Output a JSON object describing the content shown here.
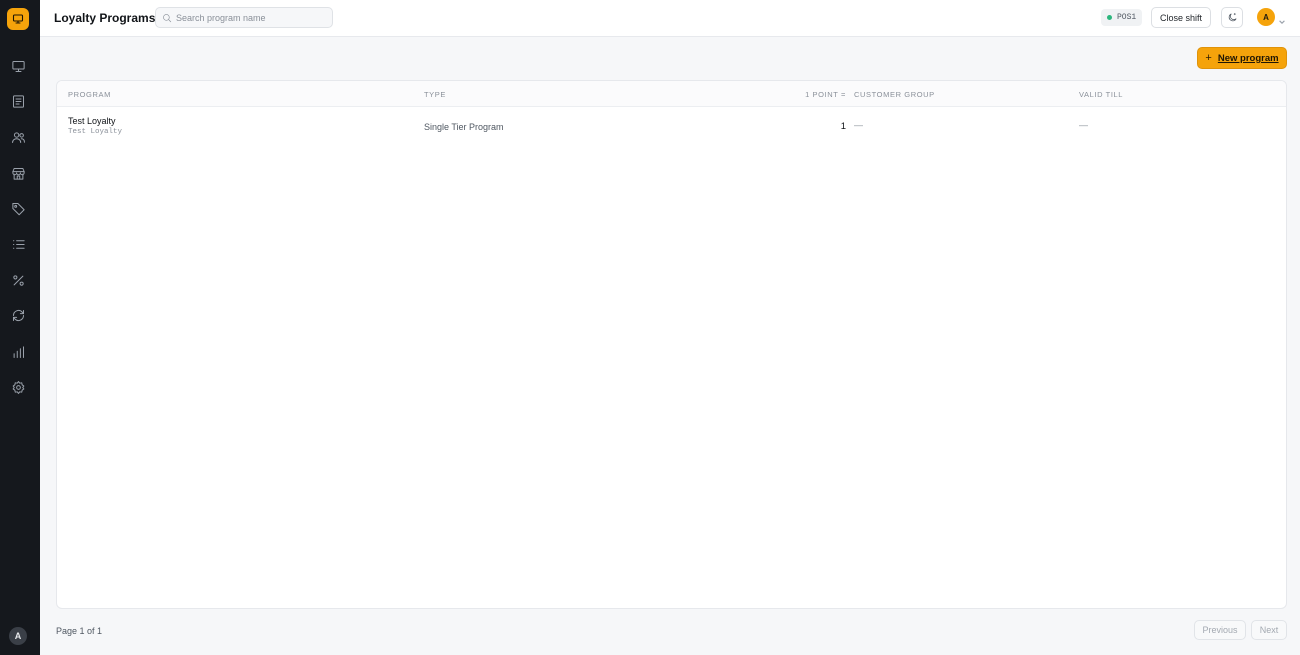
{
  "header": {
    "title": "Loyalty Programs",
    "search_placeholder": "Search program name",
    "pos_label": "POS1",
    "close_shift_label": "Close shift",
    "user_initial": "A"
  },
  "sidebar": {
    "items": [
      "monitor-icon",
      "receipt-icon",
      "users-icon",
      "store-icon",
      "tag-icon",
      "list-icon",
      "percent-icon",
      "refresh-icon",
      "bar-chart-icon",
      "gear-icon"
    ],
    "user_initial": "A"
  },
  "actions": {
    "new_program_label": "New program"
  },
  "table": {
    "columns": [
      "Program",
      "Type",
      "1 Point =",
      "Customer Group",
      "Valid Till"
    ],
    "rows": [
      {
        "name": "Test Loyalty",
        "code": "Test Loyalty",
        "type": "Single Tier Program",
        "points": "1",
        "customer_group": "—",
        "valid_till": "—"
      }
    ]
  },
  "pagination": {
    "info": "Page 1 of 1",
    "previous_label": "Previous",
    "next_label": "Next"
  },
  "colors": {
    "accent": "#f5a30b",
    "sidebar_bg": "#15181d",
    "status_online": "#2cb67d"
  }
}
